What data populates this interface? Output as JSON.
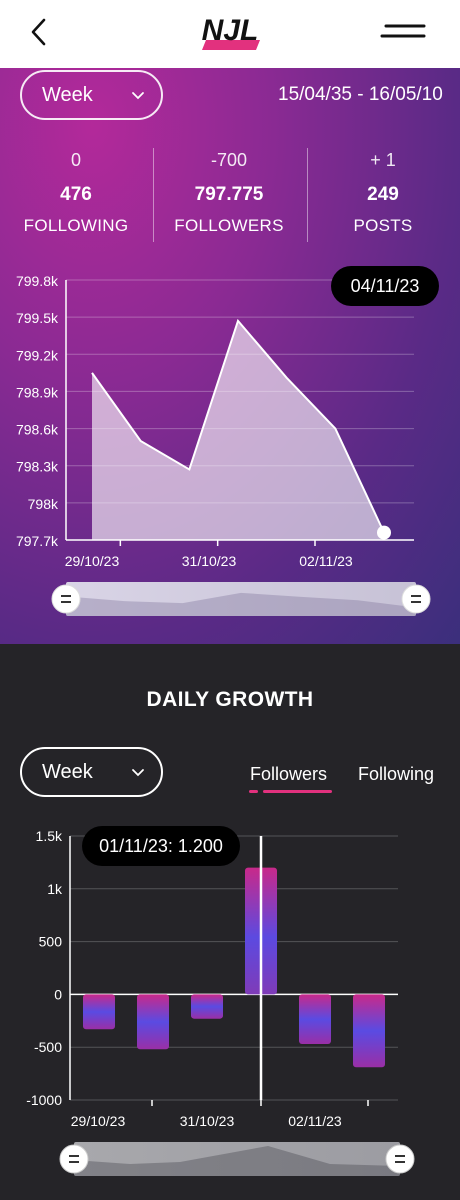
{
  "header": {
    "logo_text": "NJL",
    "back_icon": "chevron-left-icon",
    "menu_icon": "menu-icon"
  },
  "stats": {
    "period": "Week",
    "date_range": "15/04/35 - 16/05/10",
    "items": [
      {
        "delta": "0",
        "value": "476",
        "label": "FOLLOWING"
      },
      {
        "delta": "-700",
        "value": "797.775",
        "label": "FOLLOWERS"
      },
      {
        "delta": "+ 1",
        "value": "249",
        "label": "POSTS"
      }
    ],
    "tooltip": "04/11/23"
  },
  "growth": {
    "title": "DAILY GROWTH",
    "period": "Week",
    "tabs": [
      "Followers",
      "Following"
    ],
    "active_tab": "Followers",
    "tooltip": "01/11/23: 1.200"
  },
  "colors": {
    "accent": "#e2317e",
    "panel_dark": "#252428",
    "bar_top": "#c02b8e",
    "bar_mid": "#5b4ae0"
  },
  "chart_data": [
    {
      "type": "area",
      "x": [
        "29/10/23",
        "30/10/23",
        "31/10/23",
        "01/11/23",
        "02/11/23",
        "03/11/23",
        "04/11/23"
      ],
      "values": [
        799.05,
        798.5,
        798.27,
        799.47,
        799.01,
        798.6,
        797.76
      ],
      "y_ticks": [
        "799.8k",
        "799.5k",
        "799.2k",
        "798.9k",
        "798.6k",
        "798.3k",
        "798k",
        "797.7k"
      ],
      "x_tick_labels": [
        "29/10/23",
        "31/10/23",
        "02/11/23"
      ],
      "ylim": [
        797.7,
        799.8
      ],
      "grid": true,
      "highlight": "04/11/23"
    },
    {
      "type": "bar",
      "categories": [
        "29/10/23",
        "30/10/23",
        "31/10/23",
        "01/11/23",
        "02/11/23",
        "03/11/23"
      ],
      "values": [
        -330,
        -520,
        -230,
        1200,
        -470,
        -690
      ],
      "y_ticks": [
        "1.5k",
        "1k",
        "500",
        "0",
        "-500",
        "-1000"
      ],
      "x_tick_labels": [
        "29/10/23",
        "31/10/23",
        "02/11/23"
      ],
      "ylim": [
        -1000,
        1500
      ],
      "grid": true,
      "highlight": "01/11/23"
    }
  ]
}
